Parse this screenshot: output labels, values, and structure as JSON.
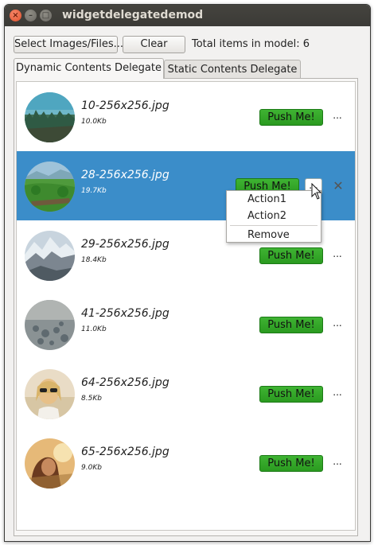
{
  "window": {
    "title": "widgetdelegatedemod"
  },
  "toolbar": {
    "select_label": "Select Images/Files...",
    "clear_label": "Clear",
    "total_text": "Total items in model: 6"
  },
  "tabs": [
    {
      "label": "Dynamic Contents Delegate",
      "active": true
    },
    {
      "label": "Static Contents Delegate",
      "active": false
    }
  ],
  "items": [
    {
      "name": "10-256x256.jpg",
      "size": "10.0Kb",
      "button": "Push Me!",
      "more": "...",
      "selected": false,
      "thumb": "forest-landscape"
    },
    {
      "name": "28-256x256.jpg",
      "size": "19.7Kb",
      "button": "Push Me!",
      "more": "...",
      "selected": true,
      "thumb": "green-valley"
    },
    {
      "name": "29-256x256.jpg",
      "size": "18.4Kb",
      "button": "Push Me!",
      "more": "...",
      "selected": false,
      "thumb": "snowy-mountains"
    },
    {
      "name": "41-256x256.jpg",
      "size": "11.0Kb",
      "button": "Push Me!",
      "more": "...",
      "selected": false,
      "thumb": "water-drops"
    },
    {
      "name": "64-256x256.jpg",
      "size": "8.5Kb",
      "button": "Push Me!",
      "more": "...",
      "selected": false,
      "thumb": "woman-sunglasses"
    },
    {
      "name": "65-256x256.jpg",
      "size": "9.0Kb",
      "button": "Push Me!",
      "more": "...",
      "selected": false,
      "thumb": "woman-sunset"
    }
  ],
  "context_menu": {
    "items": [
      "Action1",
      "Action2",
      "Remove"
    ]
  },
  "colors": {
    "selection": "#3b8dc9",
    "push_button": "#2fa526",
    "titlebar": "#3c3b37"
  }
}
